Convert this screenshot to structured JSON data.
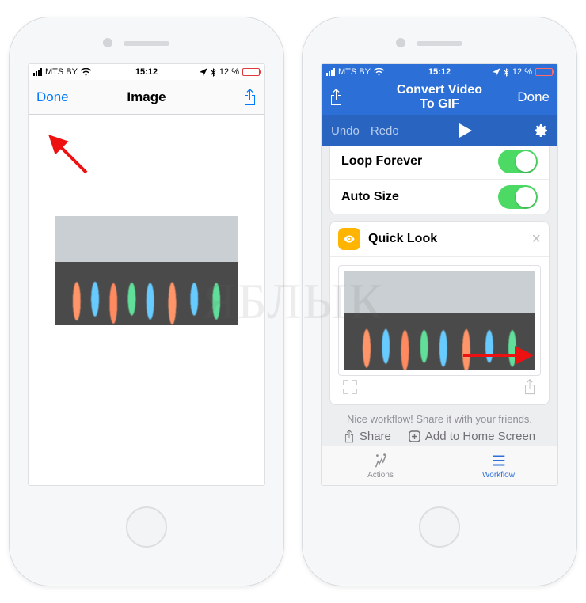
{
  "status": {
    "carrier": "MTS BY",
    "signal_icon": "signal-strength-icon",
    "wifi_icon": "wifi-icon",
    "time": "15:12",
    "location_icon": "location-arrow-icon",
    "bluetooth_icon": "bluetooth-icon",
    "battery_percent": "12 %",
    "battery_icon": "battery-low-icon"
  },
  "left": {
    "done": "Done",
    "title": "Image",
    "share_icon": "share-icon"
  },
  "right": {
    "share_icon": "share-icon",
    "title": "Convert Video To GIF",
    "done": "Done",
    "undo": "Undo",
    "redo": "Redo",
    "play_icon": "play-icon",
    "settings_icon": "gear-icon",
    "rows": {
      "loop": {
        "label": "Loop Forever",
        "value": true
      },
      "autosize": {
        "label": "Auto Size",
        "value": true
      }
    },
    "quicklook": {
      "icon": "eye-icon",
      "title": "Quick Look",
      "close_icon": "close-icon",
      "expand_icon": "expand-icon",
      "share_icon": "share-icon"
    },
    "message": "Nice workflow! Share it with your friends.",
    "share_btn": "Share",
    "add_home_btn": "Add to Home Screen",
    "tabs": {
      "actions": "Actions",
      "workflow": "Workflow"
    }
  },
  "watermark": "ЯБЛЫК"
}
